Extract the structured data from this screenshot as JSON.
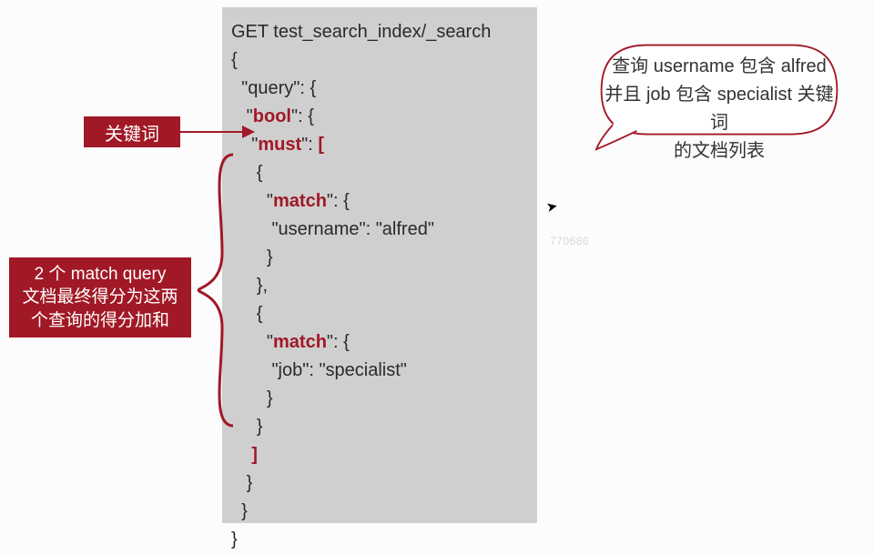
{
  "code": {
    "l1": "GET test_search_index/_search",
    "l2": "{",
    "l3a": "  \"",
    "l3b": "query",
    "l3c": "\": {",
    "l4a": "   \"",
    "l4b": "bool",
    "l4c": "\": {",
    "l5a": "    \"",
    "l5b": "must",
    "l5c": "\": ",
    "l5d": "[",
    "l6": "     {",
    "l7a": "       \"",
    "l7b": "match",
    "l7c": "\": {",
    "l8": "        \"username\": \"alfred\"",
    "l9": "       }",
    "l10": "     },",
    "l11": "     {",
    "l12a": "       \"",
    "l12b": "match",
    "l12c": "\": {",
    "l13": "        \"job\": \"specialist\"",
    "l14": "       }",
    "l15": "     }",
    "l16": "    ",
    "l16b": "]",
    "l17": "   }",
    "l18": "  }",
    "l19": "}"
  },
  "labels": {
    "keyword": "关键词",
    "matchnote_l1": "2 个 match query",
    "matchnote_l2": "文档最终得分为这两",
    "matchnote_l3": "个查询的得分加和"
  },
  "speech": {
    "l1": "查询 username 包含 alfred",
    "l2": "并且 job 包含 specialist 关键词",
    "l3": "的文档列表"
  },
  "watermark": "770686",
  "colors": {
    "accent": "#a11826",
    "panel": "#cfcfcf"
  }
}
